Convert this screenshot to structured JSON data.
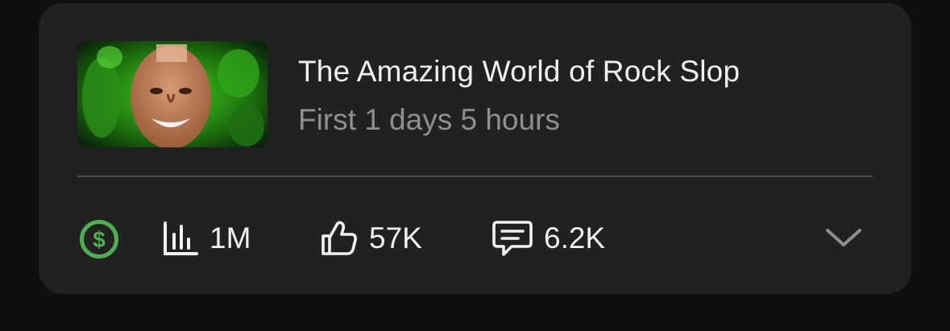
{
  "video": {
    "title": "The Amazing World of Rock Slop",
    "period": "First 1 days 5 hours"
  },
  "stats": {
    "views": "1M",
    "likes": "57K",
    "comments": "6.2K"
  },
  "icons": {
    "monetization": "dollar-circle-icon",
    "views": "bar-chart-icon",
    "likes": "thumbs-up-icon",
    "comments": "comment-icon",
    "expand": "chevron-down-icon"
  },
  "colors": {
    "card": "#212121",
    "background": "#0f0f0f",
    "monetization": "#4caf50",
    "title": "#f1f1f1",
    "subtitle": "#8f8f8f"
  }
}
